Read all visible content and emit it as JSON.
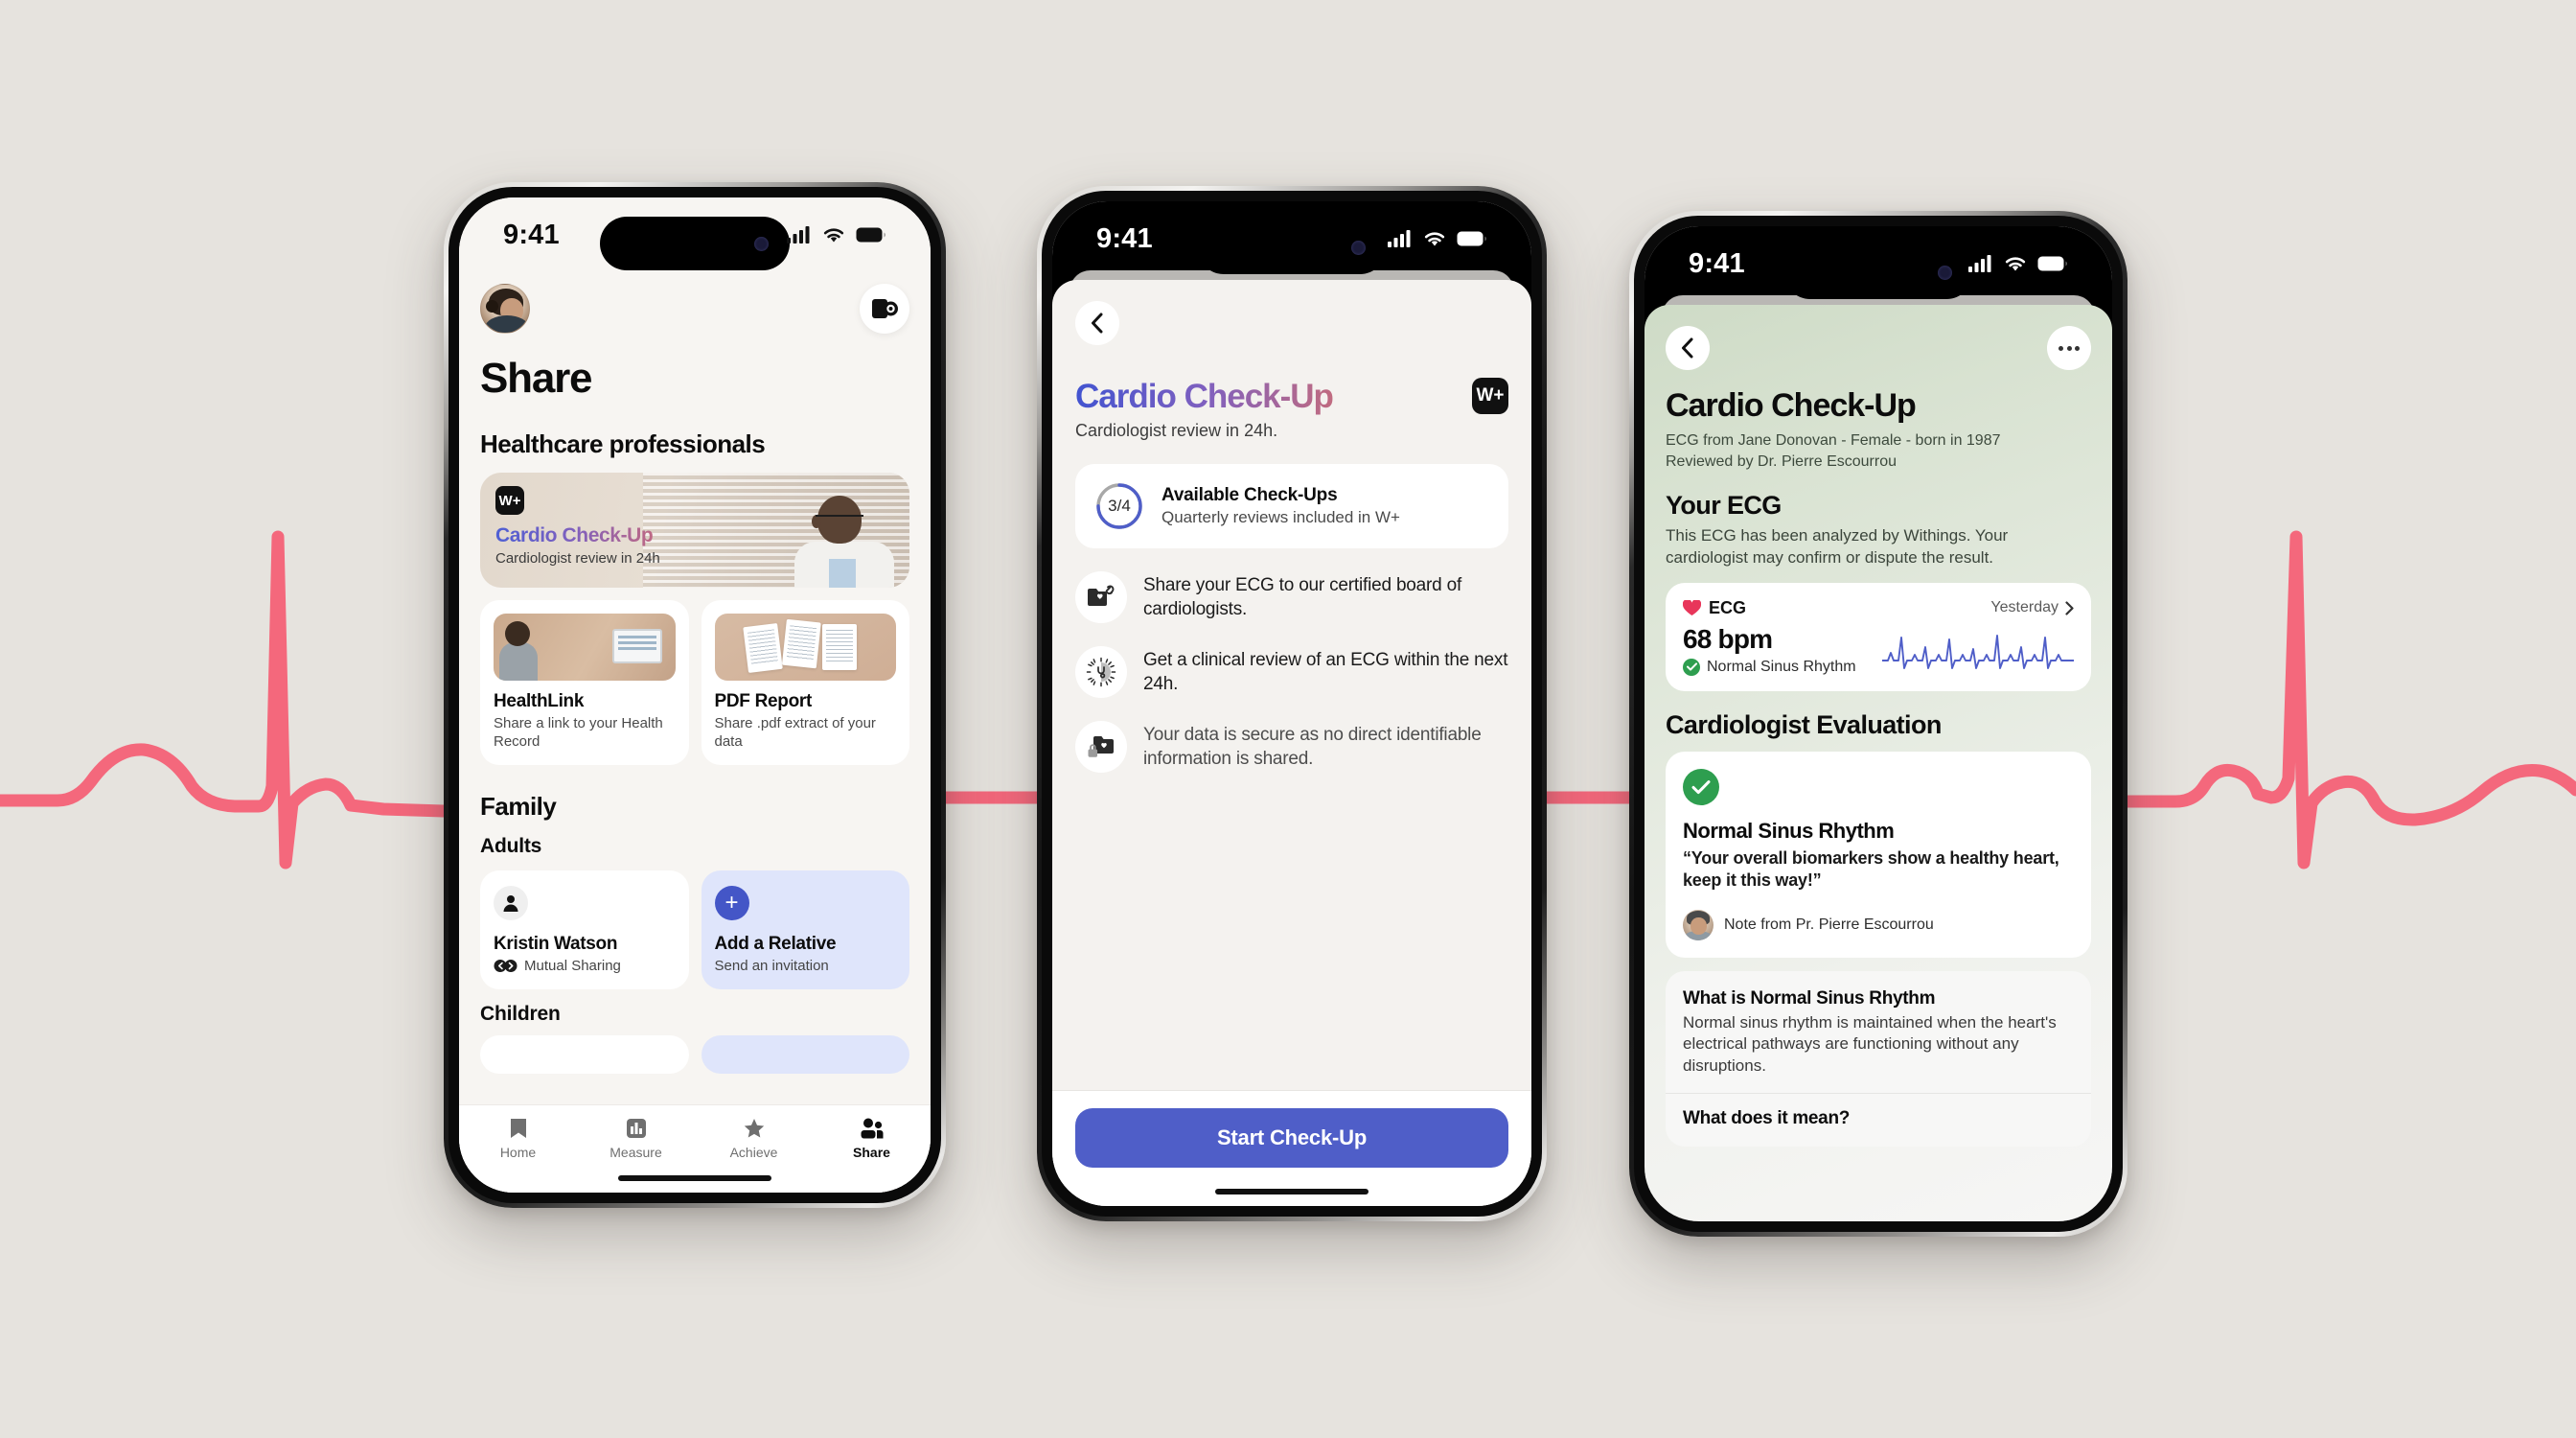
{
  "background": {
    "accent_ecg_color": "#f4687c",
    "page_bg": "#e6e3de"
  },
  "status_bar": {
    "time": "9:41"
  },
  "phone1": {
    "page_title": "Share",
    "section_healthcare": "Healthcare professionals",
    "hero": {
      "badge": "W+",
      "title": "Cardio Check-Up",
      "desc": "Cardiologist review in 24h"
    },
    "tiles": [
      {
        "name": "HealthLink",
        "desc": "Share a link to your Health Record"
      },
      {
        "name": "PDF Report",
        "desc": "Share .pdf extract of your data"
      }
    ],
    "section_family": "Family",
    "label_adults": "Adults",
    "label_children": "Children",
    "family": [
      {
        "name": "Kristin Watson",
        "meta": "Mutual Sharing"
      },
      {
        "name": "Add a Relative",
        "meta": "Send an invitation"
      }
    ],
    "tabs": [
      {
        "label": "Home",
        "icon": "bookmark-icon",
        "active": false
      },
      {
        "label": "Measure",
        "icon": "bar-chart-icon",
        "active": false
      },
      {
        "label": "Achieve",
        "icon": "star-icon",
        "active": false
      },
      {
        "label": "Share",
        "icon": "people-icon",
        "active": true
      }
    ]
  },
  "phone2": {
    "back_icon": "chevron-left-icon",
    "title": "Cardio Check-Up",
    "subtitle": "Cardiologist review in 24h.",
    "badge": "W+",
    "available": {
      "ring_value": "3/4",
      "progress": 0.75,
      "title": "Available Check-Ups",
      "desc": "Quarterly reviews included in W+"
    },
    "features": [
      {
        "icon": "share-heart-folder-icon",
        "text": "Share your ECG to our certified board of cardiologists."
      },
      {
        "icon": "clock-stethoscope-icon",
        "text": "Get a clinical review of an ECG within the next 24h."
      },
      {
        "icon": "lock-heart-folder-icon",
        "text": "Your data is secure as no direct identifiable information is shared."
      }
    ],
    "cta_label": "Start Check-Up"
  },
  "phone3": {
    "back_icon": "chevron-left-icon",
    "more_icon": "ellipsis-icon",
    "title": "Cardio Check-Up",
    "meta_line1": "ECG from Jane Donovan - Female - born in 1987",
    "meta_line2": "Reviewed by Dr. Pierre Escourrou",
    "your_ecg_heading": "Your ECG",
    "your_ecg_para": "This ECG has been analyzed by Withings. Your cardiologist may confirm or dispute the result.",
    "ecg_card": {
      "label": "ECG",
      "date": "Yesterday",
      "value": "68 bpm",
      "rhythm": "Normal Sinus Rhythm"
    },
    "evaluation_heading": "Cardiologist Evaluation",
    "evaluation": {
      "status": "Normal Sinus Rhythm",
      "quote": "“Your overall biomarkers show a healthy heart, keep it this way!”",
      "note_from": "Note from Pr. Pierre Escourrou"
    },
    "info": {
      "title": "What is Normal Sinus Rhythm",
      "body": "Normal sinus rhythm is maintained when the heart's electrical pathways are functioning without any disruptions.",
      "title2": "What does it mean?"
    }
  }
}
